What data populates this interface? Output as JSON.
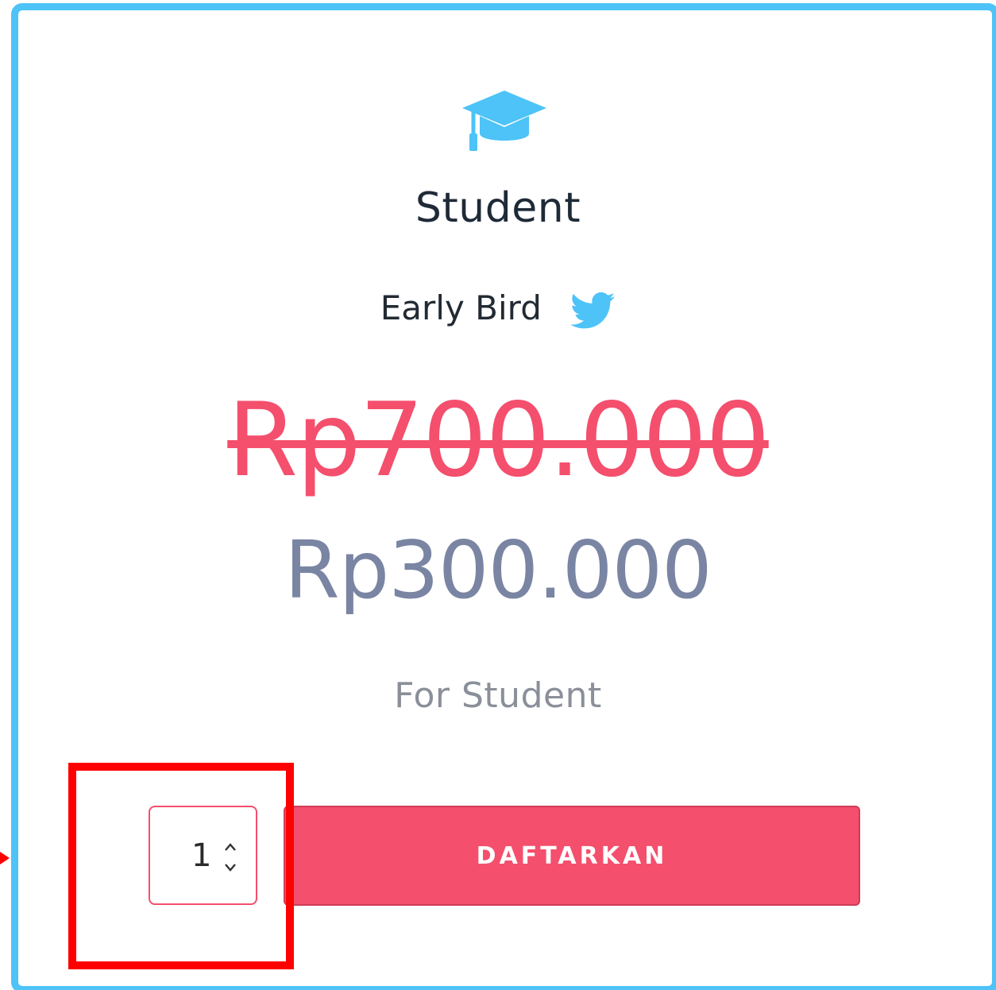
{
  "card": {
    "border_color": "#4dc3f7"
  },
  "plan": {
    "icon": "graduation-cap-icon",
    "title": "Student",
    "tier_label": "Early Bird",
    "tier_icon": "twitter-bird-icon",
    "original_price": "Rp700.000",
    "price": "Rp300.000",
    "description": "For Student"
  },
  "quantity": {
    "value": "1"
  },
  "register_button": {
    "label": "DAFTARKAN",
    "color": "#f44f6d"
  },
  "annotation": {
    "highlight_color": "#ff0000"
  }
}
